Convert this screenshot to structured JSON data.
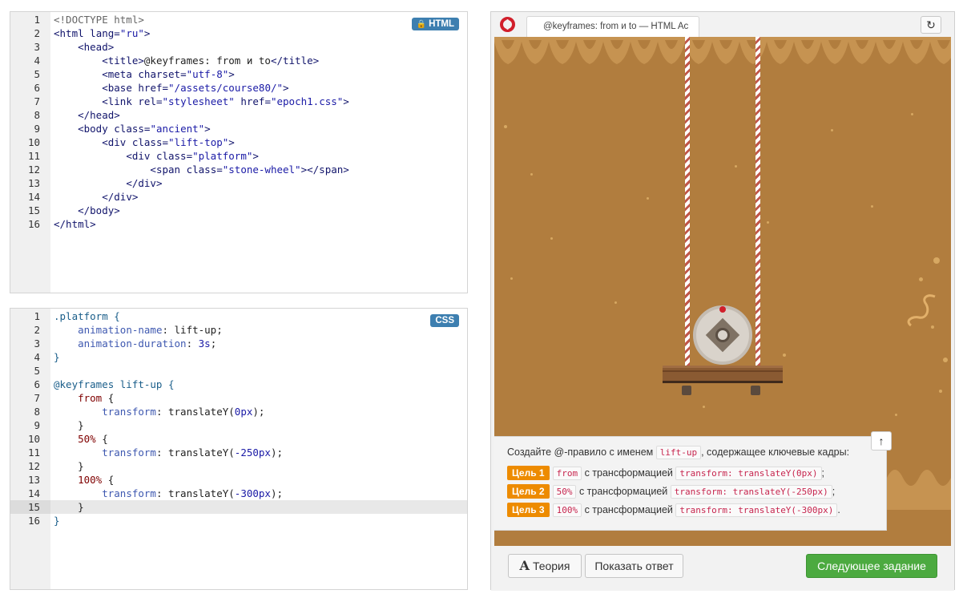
{
  "html_editor": {
    "badge": "HTML",
    "lines": [
      {
        "n": "1",
        "html": "<span class='t-grey'>&lt;!DOCTYPE html&gt;</span>"
      },
      {
        "n": "2",
        "html": "<span class='t-tag'>&lt;html</span> <span class='t-attr'>lang=</span><span class='t-str'>\"ru\"</span><span class='t-tag'>&gt;</span>"
      },
      {
        "n": "3",
        "html": "    <span class='t-tag'>&lt;head&gt;</span>"
      },
      {
        "n": "4",
        "html": "        <span class='t-tag'>&lt;title&gt;</span>@keyframes: from и to<span class='t-tag'>&lt;/title&gt;</span>"
      },
      {
        "n": "5",
        "html": "        <span class='t-tag'>&lt;meta</span> <span class='t-attr'>charset=</span><span class='t-str'>\"utf-8\"</span><span class='t-tag'>&gt;</span>"
      },
      {
        "n": "6",
        "html": "        <span class='t-tag'>&lt;base</span> <span class='t-attr'>href=</span><span class='t-str'>\"/assets/course80/\"</span><span class='t-tag'>&gt;</span>"
      },
      {
        "n": "7",
        "html": "        <span class='t-tag'>&lt;link</span> <span class='t-attr'>rel=</span><span class='t-str'>\"stylesheet\"</span> <span class='t-attr'>href=</span><span class='t-str'>\"epoch1.css\"</span><span class='t-tag'>&gt;</span>"
      },
      {
        "n": "8",
        "html": "    <span class='t-tag'>&lt;/head&gt;</span>"
      },
      {
        "n": "9",
        "html": "    <span class='t-tag'>&lt;body</span> <span class='t-attr'>class=</span><span class='t-str'>\"ancient\"</span><span class='t-tag'>&gt;</span>"
      },
      {
        "n": "10",
        "html": "        <span class='t-tag'>&lt;div</span> <span class='t-attr'>class=</span><span class='t-str'>\"lift-top\"</span><span class='t-tag'>&gt;</span>"
      },
      {
        "n": "11",
        "html": "            <span class='t-tag'>&lt;div</span> <span class='t-attr'>class=</span><span class='t-str'>\"platform\"</span><span class='t-tag'>&gt;</span>"
      },
      {
        "n": "12",
        "html": "                <span class='t-tag'>&lt;span</span> <span class='t-attr'>class=</span><span class='t-str'>\"stone-wheel\"</span><span class='t-tag'>&gt;&lt;/span&gt;</span>"
      },
      {
        "n": "13",
        "html": "            <span class='t-tag'>&lt;/div&gt;</span>"
      },
      {
        "n": "14",
        "html": "        <span class='t-tag'>&lt;/div&gt;</span>"
      },
      {
        "n": "15",
        "html": "    <span class='t-tag'>&lt;/body&gt;</span>"
      },
      {
        "n": "16",
        "html": "<span class='t-tag'>&lt;/html&gt;</span>"
      }
    ]
  },
  "css_editor": {
    "badge": "CSS",
    "active_line": 15,
    "lines": [
      {
        "n": "1",
        "html": "<span class='t-sel'>.platform {</span>"
      },
      {
        "n": "2",
        "html": "    <span class='t-prop'>animation-name</span>: lift-up;"
      },
      {
        "n": "3",
        "html": "    <span class='t-prop'>animation-duration</span>: <span class='t-num'>3s</span>;"
      },
      {
        "n": "4",
        "html": "<span class='t-sel'>}</span>"
      },
      {
        "n": "5",
        "html": ""
      },
      {
        "n": "6",
        "html": "<span class='t-at'>@keyframes lift-up {</span>"
      },
      {
        "n": "7",
        "html": "    <span class='t-kw'>from</span> {"
      },
      {
        "n": "8",
        "html": "        <span class='t-prop'>transform</span>: translateY(<span class='t-num'>0px</span>);"
      },
      {
        "n": "9",
        "html": "    }"
      },
      {
        "n": "10",
        "html": "    <span class='t-kw'>50%</span> {"
      },
      {
        "n": "11",
        "html": "        <span class='t-prop'>transform</span>: translateY(<span class='t-num'>-250px</span>);"
      },
      {
        "n": "12",
        "html": "    }"
      },
      {
        "n": "13",
        "html": "    <span class='t-kw'>100%</span> {"
      },
      {
        "n": "14",
        "html": "        <span class='t-prop'>transform</span>: translateY(<span class='t-num'>-300px</span>);"
      },
      {
        "n": "15",
        "html": "    }"
      },
      {
        "n": "16",
        "html": "<span class='t-at'>}</span>"
      }
    ]
  },
  "browser": {
    "tab_title": "@keyframes: from и to — HTML Ac",
    "reload_icon": "reload-icon"
  },
  "task": {
    "head_prefix": "Создайте @-правило с именем",
    "head_code": "lift-up",
    "head_suffix": ", содержащее ключевые кадры:",
    "goals": [
      {
        "badge": "Цель 1",
        "key": "from",
        "text": "с трансформацией",
        "code": "transform: translateY(0px)",
        "end": ";"
      },
      {
        "badge": "Цель 2",
        "key": "50%",
        "text": "с трансформацией",
        "code": "transform: translateY(-250px)",
        "end": ";"
      },
      {
        "badge": "Цель 3",
        "key": "100%",
        "text": "с трансформацией",
        "code": "transform: translateY(-300px)",
        "end": "."
      }
    ]
  },
  "buttons": {
    "theory_icon": "A",
    "theory": "Теория",
    "answer": "Показать ответ",
    "next": "Следующее задание"
  },
  "colors": {
    "accent": "#3d7fb0",
    "goal_badge": "#ed8b00",
    "next_button": "#4caa40",
    "scene_bg": "#b17d3e"
  }
}
